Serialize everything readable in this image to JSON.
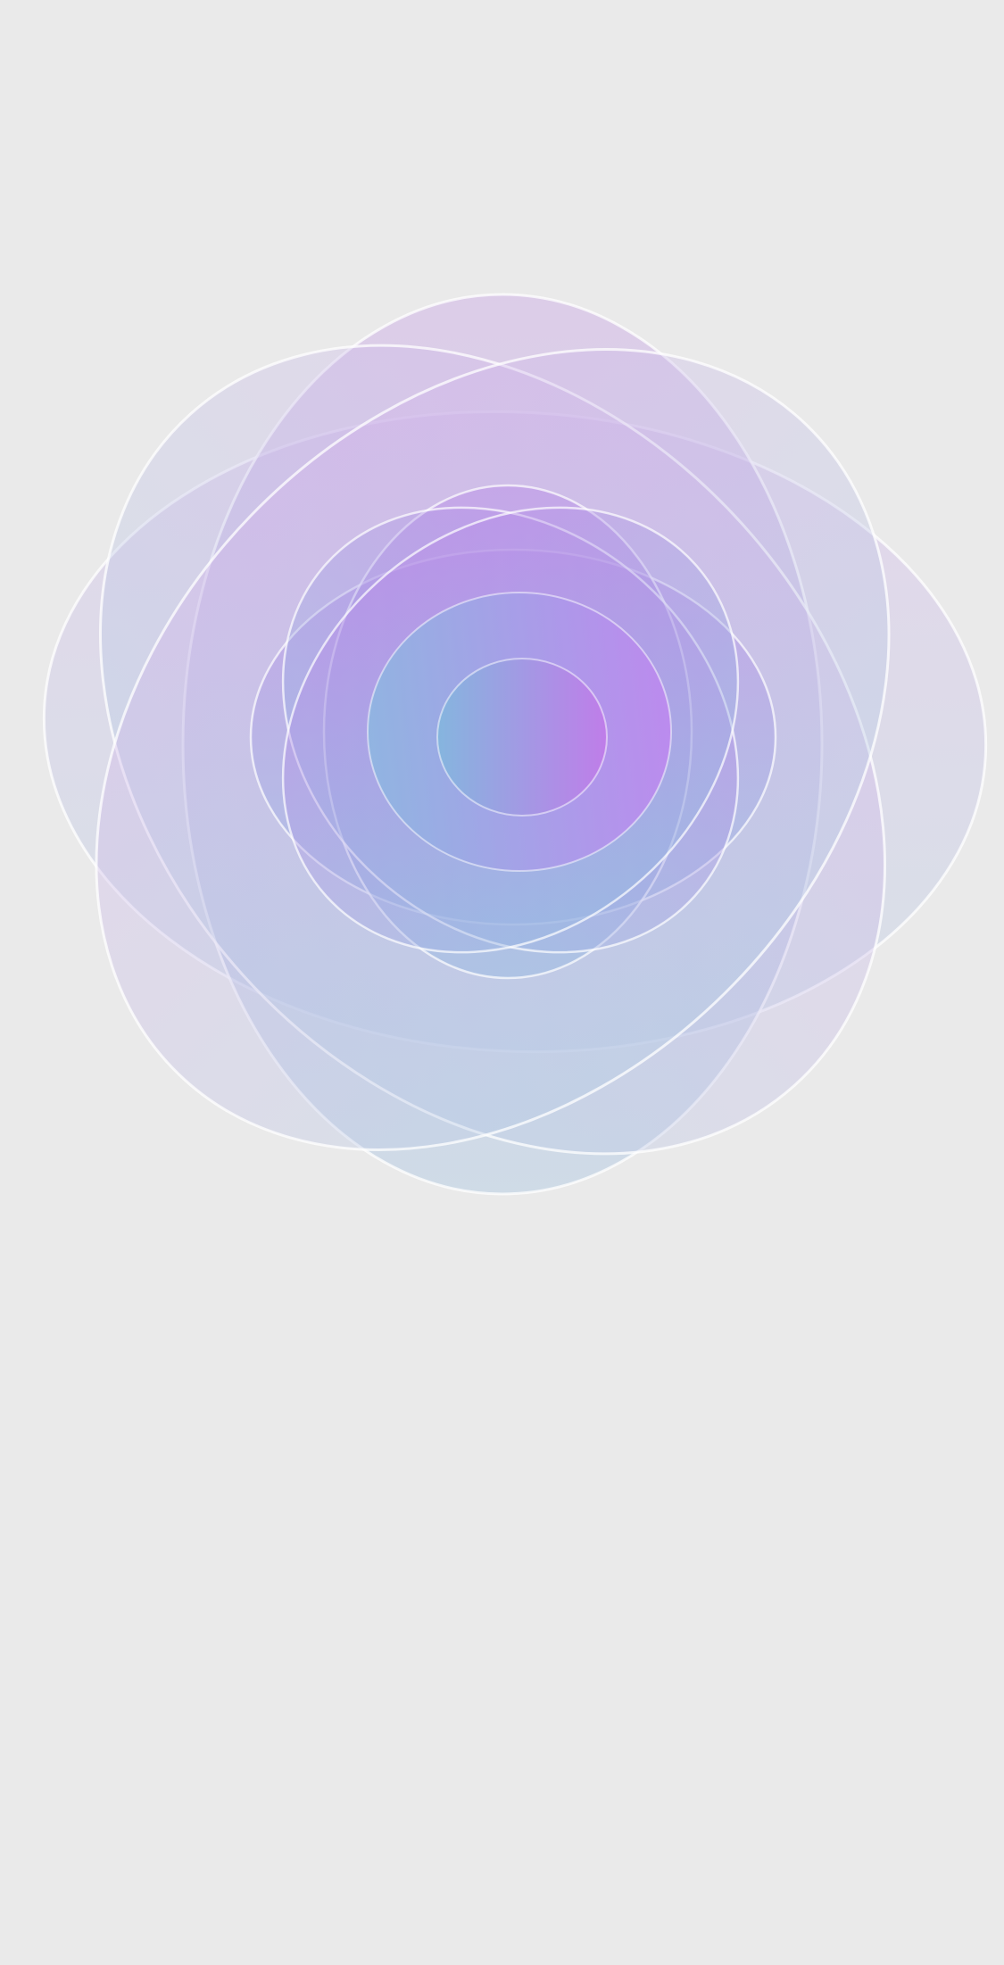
{
  "screen": {
    "background_color": "#eaeaea",
    "content": "breathing-flower-graphic"
  },
  "flower": {
    "colors": {
      "violet": "#c084f0",
      "lavender": "#c8a8e8",
      "sky_blue": "#8ab8e0",
      "pale_blue": "#b9d2e6",
      "outline": "#ffffff"
    }
  }
}
